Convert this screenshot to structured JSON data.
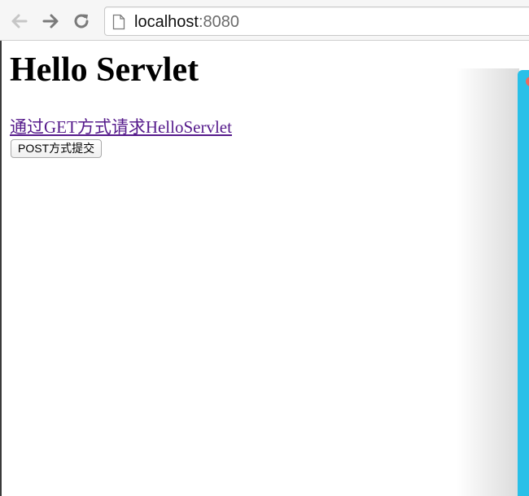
{
  "browser": {
    "url_host": "localhost",
    "url_port": ":8080",
    "icons": {
      "back": "back-arrow-icon",
      "forward": "forward-arrow-icon",
      "reload": "reload-icon",
      "page": "page-icon"
    }
  },
  "page": {
    "title": "Hello Servlet",
    "get_link_text": "通过GET方式请求HelloServlet",
    "post_button_label": "POST方式提交"
  },
  "colors": {
    "visited_link": "#551a8b",
    "side_window": "#29c0e8",
    "side_window_close": "#ee6a5f"
  }
}
